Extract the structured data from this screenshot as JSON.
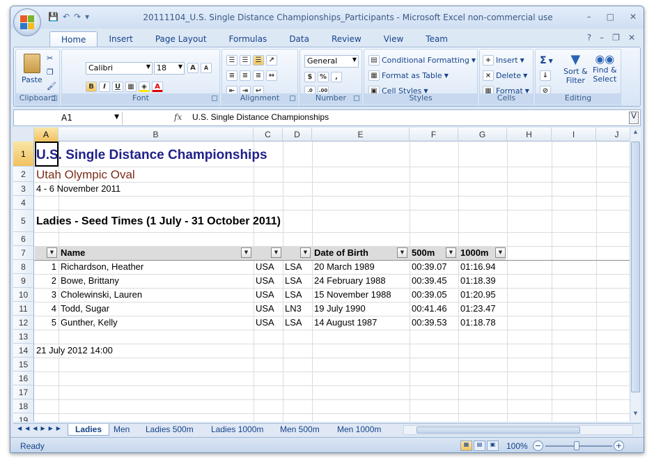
{
  "window": {
    "title": "20111104_U.S. Single Distance Championships_Participants - Microsoft Excel non-commercial use",
    "controls": [
      "–",
      "□",
      "✕"
    ]
  },
  "ribbon_tabs": [
    "Home",
    "Insert",
    "Page Layout",
    "Formulas",
    "Data",
    "Review",
    "View",
    "Team"
  ],
  "ribbon": {
    "clipboard": {
      "label": "Clipboard",
      "paste": "Paste"
    },
    "font": {
      "label": "Font",
      "name": "Calibri",
      "size": "18",
      "bold": "B",
      "italic": "I",
      "underline": "U"
    },
    "alignment": {
      "label": "Alignment"
    },
    "number": {
      "label": "Number",
      "format": "General",
      "currency": "$",
      "percent": "%",
      "comma": ","
    },
    "styles": {
      "label": "Styles",
      "conditional": "Conditional Formatting",
      "format_table": "Format as Table",
      "cell_styles": "Cell Styles"
    },
    "cells": {
      "label": "Cells",
      "insert": "Insert",
      "delete": "Delete",
      "format": "Format"
    },
    "editing": {
      "label": "Editing",
      "sort": "Sort &",
      "filter": "Filter",
      "find": "Find &",
      "select": "Select"
    }
  },
  "formula_bar": {
    "name_box": "A1",
    "fx": "fx",
    "content": "U.S. Single Distance Championships"
  },
  "columns": [
    "A",
    "B",
    "C",
    "D",
    "E",
    "F",
    "G",
    "H",
    "I",
    "J"
  ],
  "rows": [
    "1",
    "2",
    "3",
    "4",
    "5",
    "6",
    "7",
    "8",
    "9",
    "10",
    "11",
    "12",
    "13",
    "14",
    "15",
    "16",
    "17",
    "18",
    "19"
  ],
  "sheet": {
    "title": "U.S. Single Distance Championships",
    "venue": "Utah Olympic Oval",
    "dates": "4 - 6 November 2011",
    "section": "Ladies - Seed Times (1 July - 31 October 2011)",
    "headers": {
      "name": "Name",
      "dob": "Date of Birth",
      "m500": "500m",
      "m1000": "1000m"
    },
    "entries": [
      {
        "num": "1",
        "name": "Richardson, Heather",
        "country": "USA",
        "club": "LSA",
        "dob": "20 March 1989",
        "m500": "00:39.07",
        "m1000": "01:16.94"
      },
      {
        "num": "2",
        "name": "Bowe, Brittany",
        "country": "USA",
        "club": "LSA",
        "dob": "24 February 1988",
        "m500": "00:39.45",
        "m1000": "01:18.39"
      },
      {
        "num": "3",
        "name": "Cholewinski, Lauren",
        "country": "USA",
        "club": "LSA",
        "dob": "15 November 1988",
        "m500": "00:39.05",
        "m1000": "01:20.95"
      },
      {
        "num": "4",
        "name": "Todd, Sugar",
        "country": "USA",
        "club": "LN3",
        "dob": "19 July 1990",
        "m500": "00:41.46",
        "m1000": "01:23.47"
      },
      {
        "num": "5",
        "name": "Gunther, Kelly",
        "country": "USA",
        "club": "LSA",
        "dob": "14 August 1987",
        "m500": "00:39.53",
        "m1000": "01:18.78"
      }
    ],
    "timestamp": "21 July 2012  14:00"
  },
  "sheet_tabs": [
    "Ladies",
    "Men",
    "Ladies 500m",
    "Ladies 1000m",
    "Men 500m",
    "Men 1000m"
  ],
  "status": {
    "ready": "Ready",
    "zoom": "100%"
  }
}
